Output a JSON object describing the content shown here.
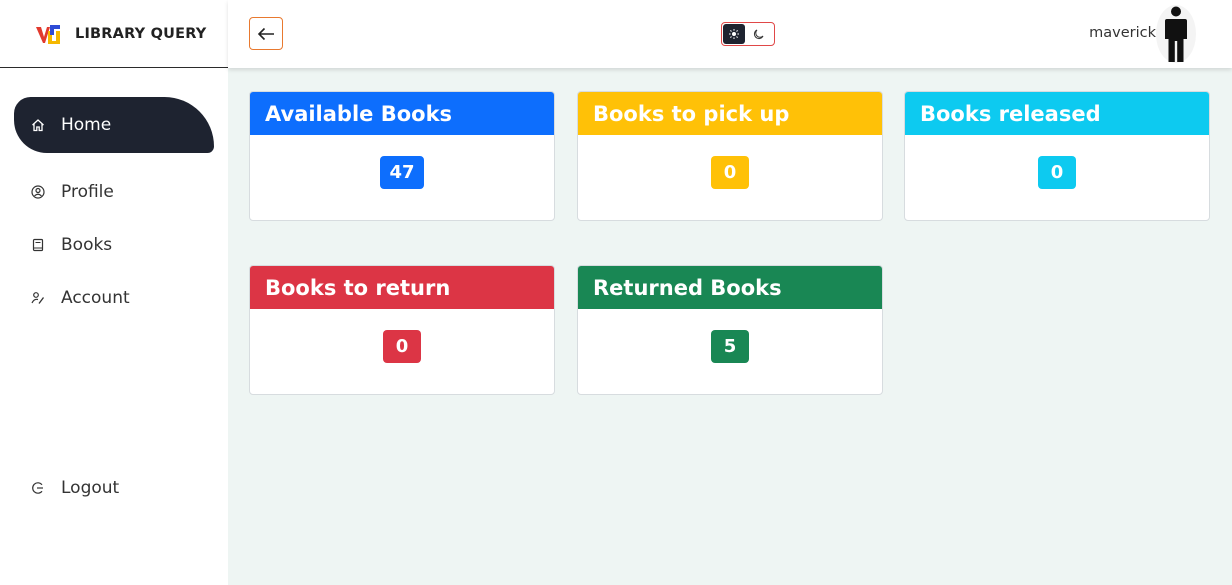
{
  "brand": {
    "title": "LIBRARY QUERY"
  },
  "sidebar": {
    "items": [
      {
        "label": "Home",
        "icon": "home-icon",
        "active": true
      },
      {
        "label": "Profile",
        "icon": "user-circle-icon"
      },
      {
        "label": "Books",
        "icon": "book-icon"
      },
      {
        "label": "Account",
        "icon": "account-settings-icon"
      }
    ],
    "logout": {
      "label": "Logout",
      "icon": "logout-icon"
    }
  },
  "header": {
    "back_icon": "arrow-left-icon",
    "theme_toggle": {
      "light_icon": "sun-icon",
      "dark_icon": "moon-icon",
      "selected": "light"
    },
    "username": "maverick",
    "avatar_icon": "person-silhouette-icon"
  },
  "cards": [
    {
      "title": "Available Books",
      "value": "47",
      "color": "#0d6efd"
    },
    {
      "title": "Books to pick up",
      "value": "0",
      "color": "#ffc107"
    },
    {
      "title": "Books released",
      "value": "0",
      "color": "#0dcaf0"
    },
    {
      "title": "Books to return",
      "value": "0",
      "color": "#dc3545"
    },
    {
      "title": "Returned Books",
      "value": "5",
      "color": "#198754"
    }
  ],
  "colors": {
    "sidebar_active": "#1e2330",
    "page_background": "#eef5f3",
    "back_button_border": "#e8792f",
    "toggle_border": "#e04848"
  }
}
